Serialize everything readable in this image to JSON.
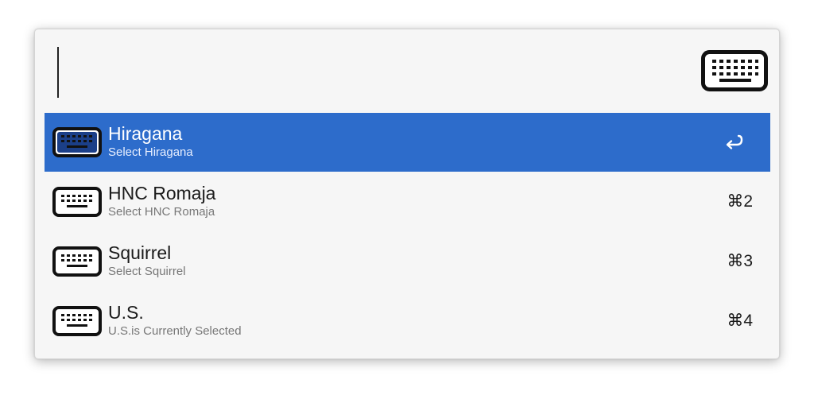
{
  "search": {
    "value": "",
    "icon": "keyboard-icon"
  },
  "results": [
    {
      "title": "Hiragana",
      "subtitle": "Select Hiragana",
      "shortcut": "",
      "selected": true,
      "icon": "keyboard-icon"
    },
    {
      "title": "HNC Romaja",
      "subtitle": "Select HNC Romaja",
      "shortcut": "⌘2",
      "selected": false,
      "icon": "keyboard-icon"
    },
    {
      "title": "Squirrel",
      "subtitle": "Select Squirrel",
      "shortcut": "⌘3",
      "selected": false,
      "icon": "keyboard-icon"
    },
    {
      "title": "U.S.",
      "subtitle": "U.S.is Currently Selected",
      "shortcut": "⌘4",
      "selected": false,
      "icon": "keyboard-icon"
    }
  ],
  "colors": {
    "selection": "#2d6ccb",
    "window_bg": "#f6f6f6",
    "subtitle": "#777777"
  }
}
